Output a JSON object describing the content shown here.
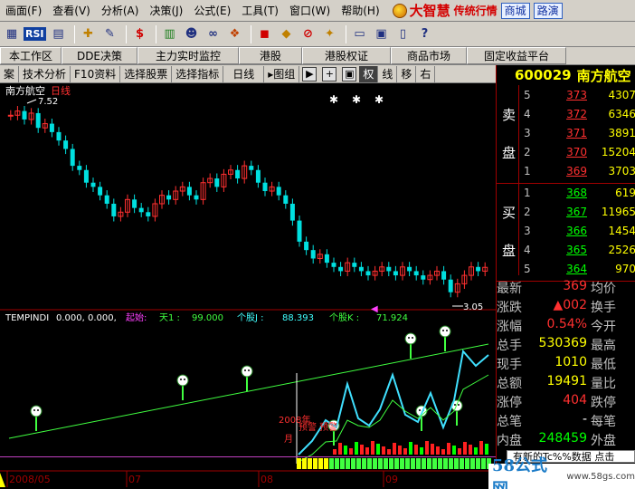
{
  "menu": [
    {
      "label": "画面(F)",
      "name": "menu-screen"
    },
    {
      "label": "查看(V)",
      "name": "menu-view"
    },
    {
      "label": "分析(A)",
      "name": "menu-analyze"
    },
    {
      "label": "决策(J)",
      "name": "menu-decision"
    },
    {
      "label": "公式(E)",
      "name": "menu-formula"
    },
    {
      "label": "工具(T)",
      "name": "menu-tools"
    },
    {
      "label": "窗口(W)",
      "name": "menu-window"
    },
    {
      "label": "帮助(H)",
      "name": "menu-help"
    }
  ],
  "brand": {
    "main": "大智慧",
    "sub": "传统行情",
    "mall": "商城",
    "route": "路演"
  },
  "toolbar": {
    "rsi": "RSI"
  },
  "tabs": [
    "本工作区",
    "DDE决策",
    "主力实时监控",
    "港股",
    "港股权证",
    "商品市场",
    "固定收益平台"
  ],
  "chart_tools": [
    "案",
    "技术分析",
    "F10资料",
    "选择股票",
    "选择指标",
    "日线",
    "图组",
    "权",
    "线",
    "移",
    "右"
  ],
  "stock": {
    "code": "600029",
    "name": "南方航空",
    "chart_label": "南方航空",
    "period": "日线",
    "high_label": "7.52",
    "low_label": "3.05"
  },
  "indicator": {
    "name": "TEMPINDI",
    "values": "0.000, 0.000,",
    "start_label": "起始:",
    "t1_label": "天1 :",
    "t1_value": "99.000",
    "j_label": "个股J :",
    "j_value": "88.393",
    "k_label": "个股K :",
    "k_value": "71.924"
  },
  "annotations": {
    "year": "2008年",
    "forecast": "预警 预警",
    "month": "月"
  },
  "x_axis": [
    "2008/05",
    "07",
    "08",
    "09"
  ],
  "sell_orders": [
    {
      "level": "5",
      "price": "373",
      "vol": "4307"
    },
    {
      "level": "4",
      "price": "372",
      "vol": "6346"
    },
    {
      "level": "3",
      "price": "371",
      "vol": "3891"
    },
    {
      "level": "2",
      "price": "370",
      "vol": "15204"
    },
    {
      "level": "1",
      "price": "369",
      "vol": "3703"
    }
  ],
  "buy_orders": [
    {
      "level": "1",
      "price": "368",
      "vol": "619"
    },
    {
      "level": "2",
      "price": "367",
      "vol": "11965"
    },
    {
      "level": "3",
      "price": "366",
      "vol": "1454"
    },
    {
      "level": "4",
      "price": "365",
      "vol": "2526"
    },
    {
      "level": "5",
      "price": "364",
      "vol": "970"
    }
  ],
  "sell_side": [
    "卖",
    "盘"
  ],
  "buy_side": [
    "买",
    "盘"
  ],
  "stats": [
    {
      "label": "最新",
      "value": "369",
      "color": "red",
      "label2": "均价"
    },
    {
      "label": "涨跌",
      "value": "▲002",
      "color": "red",
      "label2": "换手"
    },
    {
      "label": "涨幅",
      "value": "0.54%",
      "color": "red",
      "label2": "今开"
    },
    {
      "label": "总手",
      "value": "530369",
      "color": "yel",
      "label2": "最高"
    },
    {
      "label": "现手",
      "value": "1010",
      "color": "yel",
      "label2": "最低"
    },
    {
      "label": "总额",
      "value": "19491",
      "color": "yel",
      "label2": "量比"
    },
    {
      "label": "涨停",
      "value": "404",
      "color": "red",
      "label2": "跌停"
    },
    {
      "label": "总笔",
      "value": "-",
      "color": "wht",
      "label2": "每笔"
    },
    {
      "label": "内盘",
      "value": "248459",
      "color": "grn",
      "label2": "外盘"
    }
  ],
  "bottom_strip": "有新的Tc%%数据 点击",
  "watermark": {
    "main": "58公式网",
    "url": "www.58gs.com"
  },
  "chart_data": {
    "type": "candlestick",
    "unit": "yuan",
    "high_point": 7.52,
    "low_point": 3.05,
    "close_series": [
      7.3,
      7.4,
      7.2,
      7.35,
      7.0,
      7.1,
      6.9,
      6.7,
      6.5,
      6.1,
      6.0,
      5.7,
      5.6,
      5.4,
      5.2,
      4.9,
      5.0,
      5.3,
      5.1,
      5.0,
      4.9,
      5.2,
      5.4,
      5.3,
      5.5,
      5.6,
      5.4,
      5.3,
      5.7,
      5.8,
      5.6,
      5.9,
      6.0,
      5.8,
      6.1,
      6.0,
      5.7,
      5.5,
      5.6,
      5.4,
      5.2,
      4.8,
      4.3,
      4.1,
      3.9,
      4.0,
      3.8,
      3.7,
      3.6,
      3.8,
      3.7,
      3.6,
      3.5,
      3.6,
      3.7,
      3.6,
      3.5,
      3.7,
      3.6,
      3.5,
      3.4,
      3.5,
      3.6,
      3.4,
      3.1,
      3.3,
      3.5,
      3.7,
      3.6,
      3.69
    ],
    "ylim": [
      2.9,
      7.8
    ]
  }
}
